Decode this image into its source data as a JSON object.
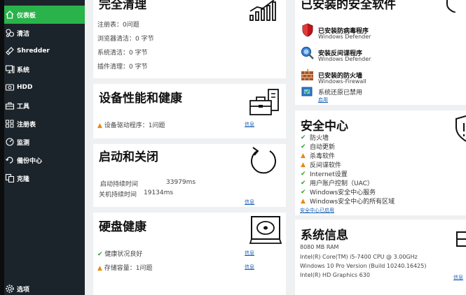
{
  "sidebar": {
    "items": [
      {
        "label": "仪表板",
        "icon": "home-icon",
        "active": true
      },
      {
        "label": "清洁",
        "icon": "bubbles-icon"
      },
      {
        "label": "Shredder",
        "icon": "shredder-icon"
      },
      {
        "label": "系统",
        "icon": "system-icon"
      },
      {
        "label": "HDD",
        "icon": "hdd-icon"
      },
      {
        "label": "工具",
        "icon": "toolbox-icon"
      },
      {
        "label": "注册表",
        "icon": "registry-icon"
      },
      {
        "label": "监测",
        "icon": "monitor-icon"
      },
      {
        "label": "備份中心",
        "icon": "backup-icon"
      },
      {
        "label": "克隆",
        "icon": "clone-icon"
      }
    ],
    "options_label": "选项"
  },
  "cleanup": {
    "title": "完全清理",
    "lines": [
      "注册表：0问题",
      "浏览器清洁：0 字节",
      "系统清洁：0 字节",
      "插件清理：0 字节"
    ]
  },
  "performance": {
    "title": "设备性能和健康",
    "item": "设备驱动程序：1问题",
    "link": "信息"
  },
  "startup": {
    "title": "启动和关闭",
    "startup_label": "启动持续时间",
    "startup_value": "33979ms",
    "shutdown_label": "关机持续时间",
    "shutdown_value": "19134ms",
    "link": "信息"
  },
  "disk": {
    "title": "硬盘健康",
    "item1": "健康状况良好",
    "item2": "存储容量：1问题",
    "link1": "信息",
    "link2": "信息"
  },
  "security_software": {
    "title": "已安装的安全软件",
    "antivirus_title": "已安装防病毒程序",
    "antivirus_name": "Windows Defender",
    "antispyware_title": "安装反间谍程序",
    "antispyware_name": "Windows Defender",
    "firewall_title": "已安装的防火墙",
    "firewall_name": "Windows-Firewall",
    "restore_text": "系统还原已禁用",
    "restore_link": "启用"
  },
  "security_center": {
    "title": "安全中心",
    "items": [
      {
        "label": "防火墙",
        "status": "ok"
      },
      {
        "label": "自动更新",
        "status": "ok"
      },
      {
        "label": "杀毒软件",
        "status": "warn"
      },
      {
        "label": "反间谍软件",
        "status": "warn"
      },
      {
        "label": "Internet设置",
        "status": "ok"
      },
      {
        "label": "用户账户控制（UAC）",
        "status": "ok"
      },
      {
        "label": "Windows安全中心服务",
        "status": "ok"
      },
      {
        "label": "Windows安全中心的所有区域",
        "status": "warn"
      }
    ],
    "link": "安全中心已启用"
  },
  "system_info": {
    "title": "系统信息",
    "lines": [
      "8080 MB RAM",
      "Intel(R) Core(TM) i5-7400 CPU @ 3.00GHz",
      "Windows 10 Pro Version  (Build 10240.16425)",
      "Intel(R) HD Graphics 630"
    ],
    "link": "信息"
  },
  "colors": {
    "sidebar_bg": "#1c242b",
    "active": "#29b34a",
    "ok": "#2a9d3c",
    "warn": "#e8890c",
    "link": "#1a5fb4"
  }
}
